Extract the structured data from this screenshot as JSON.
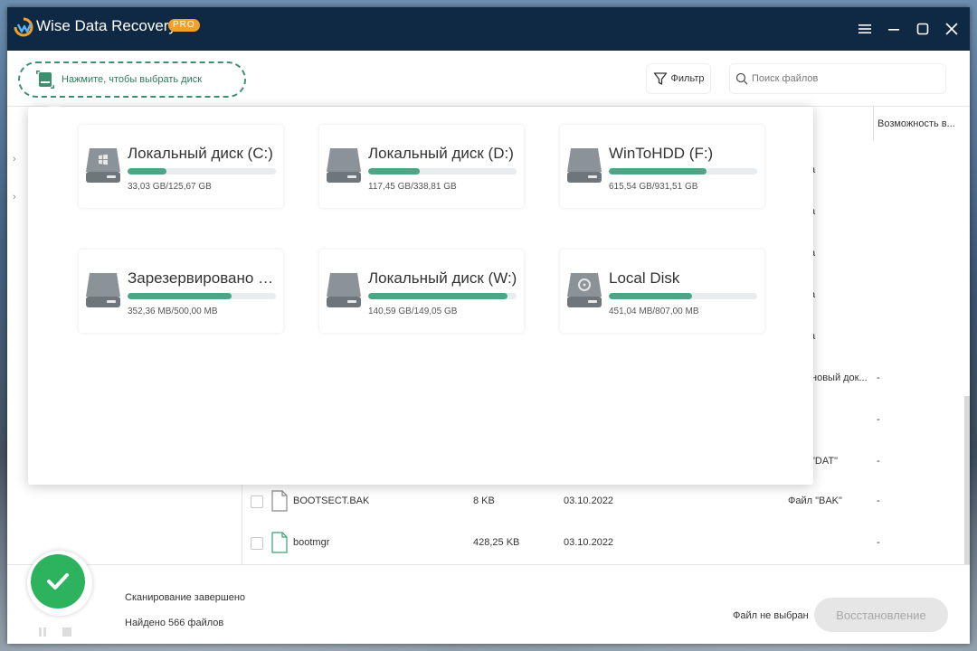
{
  "app": {
    "title": "Wise Data Recovery",
    "badge": "PRO"
  },
  "toolbar": {
    "disk_select_label": "Нажмите, чтобы выбрать диск",
    "filter_label": "Фильтр",
    "search_placeholder": "Поиск файлов"
  },
  "list": {
    "column_recoverability": "Возможность в...",
    "fragment_cells": [
      "а",
      "а",
      "а",
      "а",
      "а"
    ],
    "partial_rows": [
      {
        "type": "новый док...",
        "recoverability": "-"
      },
      {
        "type": "",
        "recoverability": "-"
      },
      {
        "type": "\"DAT\"",
        "recoverability": "-"
      }
    ],
    "rows": [
      {
        "name": "BOOTSECT.BAK",
        "size": "8 KB",
        "date": "03.10.2022",
        "type": "Файл \"BAK\"",
        "recoverability": "-"
      },
      {
        "name": "bootmgr",
        "size": "428,25 KB",
        "date": "03.10.2022",
        "type": "",
        "recoverability": "-"
      }
    ]
  },
  "disks": [
    {
      "name": "Локальный диск (C:)",
      "size": "33,03 GB/125,67 GB",
      "used": 0.26,
      "icon": "windows-drive-icon"
    },
    {
      "name": "Локальный диск (D:)",
      "size": "117,45 GB/338,81 GB",
      "used": 0.35,
      "icon": "hard-drive-icon"
    },
    {
      "name": "WinToHDD (F:)",
      "size": "615,54 GB/931,51 GB",
      "used": 0.66,
      "icon": "hard-drive-icon"
    },
    {
      "name": "Зарезервировано системой",
      "size": "352,36 MB/500,00 MB",
      "used": 0.7,
      "icon": "hard-drive-icon"
    },
    {
      "name": "Локальный диск (W:)",
      "size": "140,59 GB/149,05 GB",
      "used": 0.94,
      "icon": "hard-drive-icon"
    },
    {
      "name": "Local Disk",
      "size": "451,04 MB/807,00 MB",
      "used": 0.56,
      "icon": "optical-drive-icon"
    }
  ],
  "status": {
    "scan_complete": "Сканирование завершено",
    "found": "Найдено 566 файлов",
    "no_file_selected": "Файл не выбран",
    "restore_label": "Восстановление"
  },
  "colors": {
    "titlebar": "#0f2944",
    "accent": "#4ea585",
    "success": "#2db35d",
    "badge": "#f0a12d"
  }
}
